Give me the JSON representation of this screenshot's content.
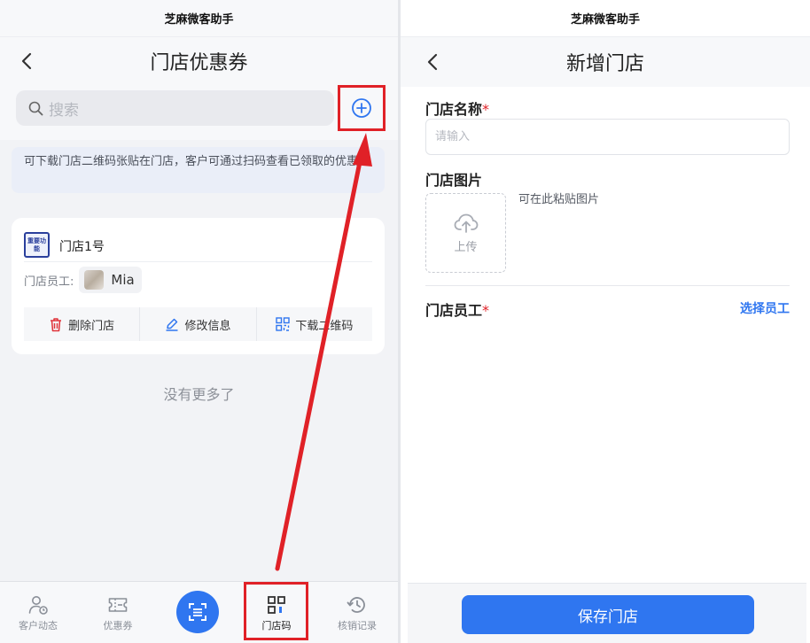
{
  "left": {
    "app_title": "芝麻微客助手",
    "nav_title": "门店优惠券",
    "search": {
      "placeholder": "搜索"
    },
    "tip": "可下载门店二维码张贴在门店，客户可通过扫码查看已领取的优惠券",
    "store": {
      "badge": "重要功能",
      "name": "门店1号",
      "staff_label": "门店员工:",
      "staff": [
        {
          "name": "Mia"
        }
      ],
      "actions": [
        "删除门店",
        "修改信息",
        "下载二维码"
      ]
    },
    "no_more": "没有更多了",
    "tabs": [
      {
        "label": "客户动态",
        "icon": "customer-activity-icon"
      },
      {
        "label": "优惠券",
        "icon": "coupon-icon"
      },
      {
        "label": "",
        "icon": "scan-icon"
      },
      {
        "label": "门店码",
        "icon": "qr-code-icon",
        "active": true
      },
      {
        "label": "核销记录",
        "icon": "history-icon"
      }
    ]
  },
  "right": {
    "app_title": "芝麻微客助手",
    "nav_title": "新增门店",
    "fields": {
      "name_label": "门店名称",
      "name_placeholder": "请输入",
      "image_label": "门店图片",
      "upload_label": "上传",
      "paste_hint": "可在此粘贴图片",
      "staff_label": "门店员工",
      "choose_staff": "选择员工",
      "required_mark": "*"
    },
    "save_button": "保存门店"
  },
  "colors": {
    "primary": "#2f76f0",
    "highlight_red": "#e02127",
    "delete_red": "#e0343a"
  }
}
